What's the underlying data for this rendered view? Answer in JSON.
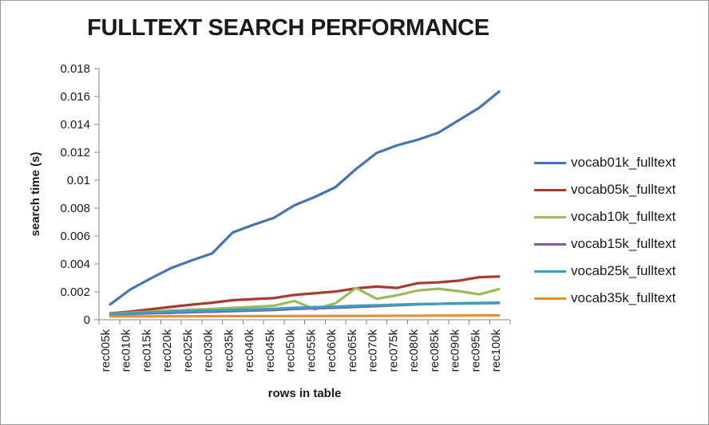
{
  "chart_data": {
    "type": "line",
    "title": "FULLTEXT SEARCH PERFORMANCE",
    "xlabel": "rows in table",
    "ylabel": "search time (s)",
    "grid": false,
    "legend_position": "right",
    "ylim": [
      0,
      0.018
    ],
    "yticks": [
      0,
      0.002,
      0.004,
      0.006,
      0.008,
      0.01,
      0.012,
      0.014,
      0.016,
      0.018
    ],
    "ytick_labels": [
      "0",
      "0.002",
      "0.004",
      "0.006",
      "0.008",
      "0.01",
      "0.012",
      "0.014",
      "0.016",
      "0.018"
    ],
    "categories": [
      "rec005k",
      "rec010k",
      "rec015k",
      "rec020k",
      "rec025k",
      "rec030k",
      "rec035k",
      "rec040k",
      "rec045k",
      "rec050k",
      "rec055k",
      "rec060k",
      "rec065k",
      "rec070k",
      "rec075k",
      "rec080k",
      "rec085k",
      "rec090k",
      "rec095k",
      "rec100k"
    ],
    "series": [
      {
        "name": "vocab01k_fulltext",
        "color": "#4674B2",
        "values": [
          0.00105,
          0.00215,
          0.00295,
          0.0037,
          0.00425,
          0.00475,
          0.00625,
          0.0068,
          0.0073,
          0.0082,
          0.0088,
          0.0095,
          0.0108,
          0.01195,
          0.0125,
          0.0129,
          0.0134,
          0.0143,
          0.0152,
          0.0164
        ]
      },
      {
        "name": "vocab05k_fulltext",
        "color": "#A93B35",
        "values": [
          0.00045,
          0.00058,
          0.00075,
          0.00092,
          0.00108,
          0.00122,
          0.0014,
          0.00148,
          0.00155,
          0.00178,
          0.0019,
          0.00202,
          0.00225,
          0.00238,
          0.00228,
          0.00262,
          0.00268,
          0.0028,
          0.00305,
          0.0031
        ]
      },
      {
        "name": "vocab10k_fulltext",
        "color": "#9BBB59",
        "values": [
          0.00042,
          0.0005,
          0.00058,
          0.00066,
          0.00072,
          0.00078,
          0.00085,
          0.00092,
          0.001,
          0.00135,
          0.00075,
          0.00118,
          0.00228,
          0.0015,
          0.00175,
          0.0021,
          0.00222,
          0.00205,
          0.00182,
          0.00222
        ]
      },
      {
        "name": "vocab15k_fulltext",
        "color": "#7B5EA0",
        "values": [
          0.00038,
          0.00042,
          0.00046,
          0.0005,
          0.00054,
          0.00058,
          0.00062,
          0.00066,
          0.0007,
          0.00078,
          0.00082,
          0.00086,
          0.00092,
          0.00098,
          0.00104,
          0.0011,
          0.00114,
          0.00118,
          0.0012,
          0.00122
        ]
      },
      {
        "name": "vocab25k_fulltext",
        "color": "#3C9FBD",
        "values": [
          0.0004,
          0.00046,
          0.00052,
          0.00058,
          0.00062,
          0.00066,
          0.0007,
          0.00074,
          0.00078,
          0.00086,
          0.0009,
          0.00094,
          0.001,
          0.00104,
          0.00108,
          0.00112,
          0.00114,
          0.00116,
          0.00118,
          0.0012
        ]
      },
      {
        "name": "vocab35k_fulltext",
        "color": "#E8902D",
        "values": [
          0.00024,
          0.00024,
          0.00024,
          0.00025,
          0.00025,
          0.00025,
          0.00026,
          0.00026,
          0.00026,
          0.00027,
          0.00027,
          0.00027,
          0.00028,
          0.00028,
          0.00029,
          0.00029,
          0.0003,
          0.0003,
          0.00031,
          0.00031
        ]
      }
    ]
  },
  "legend": {
    "items": [
      {
        "label": "vocab01k_fulltext",
        "color": "#4674B2"
      },
      {
        "label": "vocab05k_fulltext",
        "color": "#A93B35"
      },
      {
        "label": "vocab10k_fulltext",
        "color": "#9BBB59"
      },
      {
        "label": "vocab15k_fulltext",
        "color": "#7B5EA0"
      },
      {
        "label": "vocab25k_fulltext",
        "color": "#3C9FBD"
      },
      {
        "label": "vocab35k_fulltext",
        "color": "#E8902D"
      }
    ]
  }
}
